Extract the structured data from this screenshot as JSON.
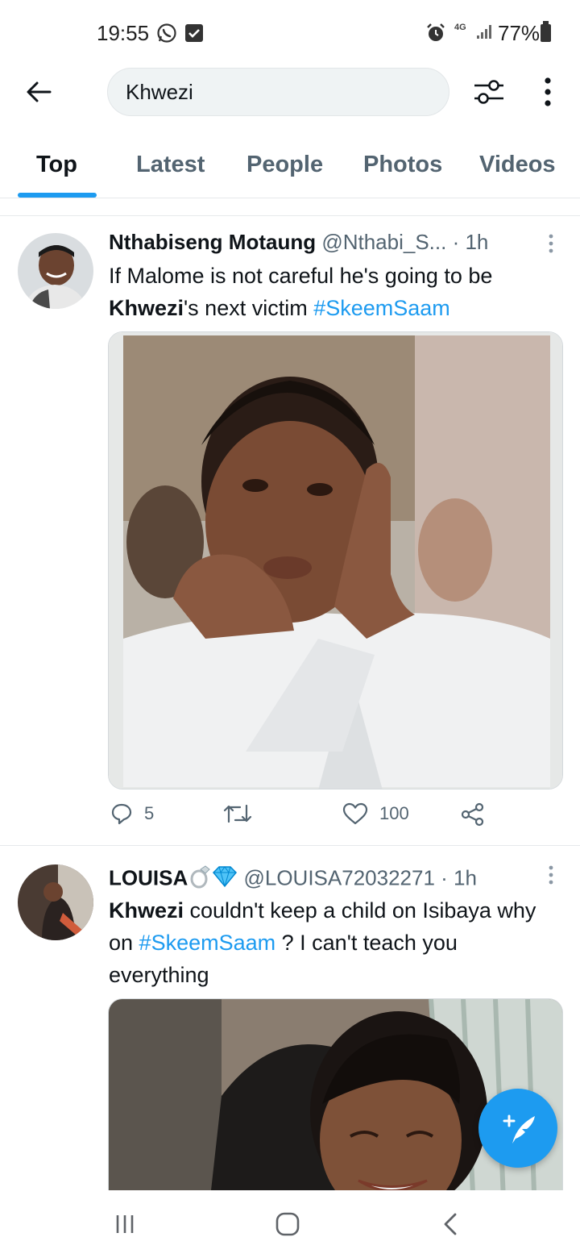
{
  "status_bar": {
    "time": "19:55",
    "network": "4G",
    "battery": "77%",
    "icons": [
      "whatsapp-icon",
      "check-notification-icon",
      "alarm-icon",
      "signal-icon",
      "battery-icon"
    ]
  },
  "search": {
    "query": "Khwezi",
    "icons": [
      "back-arrow-icon",
      "filter-sliders-icon",
      "more-vertical-icon"
    ]
  },
  "tabs": [
    {
      "label": "Top",
      "active": true
    },
    {
      "label": "Latest",
      "active": false
    },
    {
      "label": "People",
      "active": false
    },
    {
      "label": "Photos",
      "active": false
    },
    {
      "label": "Videos",
      "active": false
    }
  ],
  "tweets": [
    {
      "name": "Nthabiseng Motaung",
      "handle": "@Nthabi_S...",
      "time": "· 1h",
      "text_bold": "Khwezi",
      "text_before": "If Malome is not careful he's going to be",
      "text_after": "'s next victim",
      "hashtag": "#SkeemSaam",
      "replies": "5",
      "retweets": "",
      "likes": "100"
    },
    {
      "name": "LOUISA",
      "handle": "@LOUISA72032271",
      "time": "· 1h",
      "text_bold": "Khwezi",
      "text_mid": " couldn't keep a child  on Isibaya why on ",
      "hashtag": "#SkeemSaam",
      "text_after": " ? I can't teach you everything"
    }
  ],
  "colors": {
    "accent": "#1d9bf0",
    "secondary_text": "#536471",
    "primary_text": "#0f1419"
  }
}
